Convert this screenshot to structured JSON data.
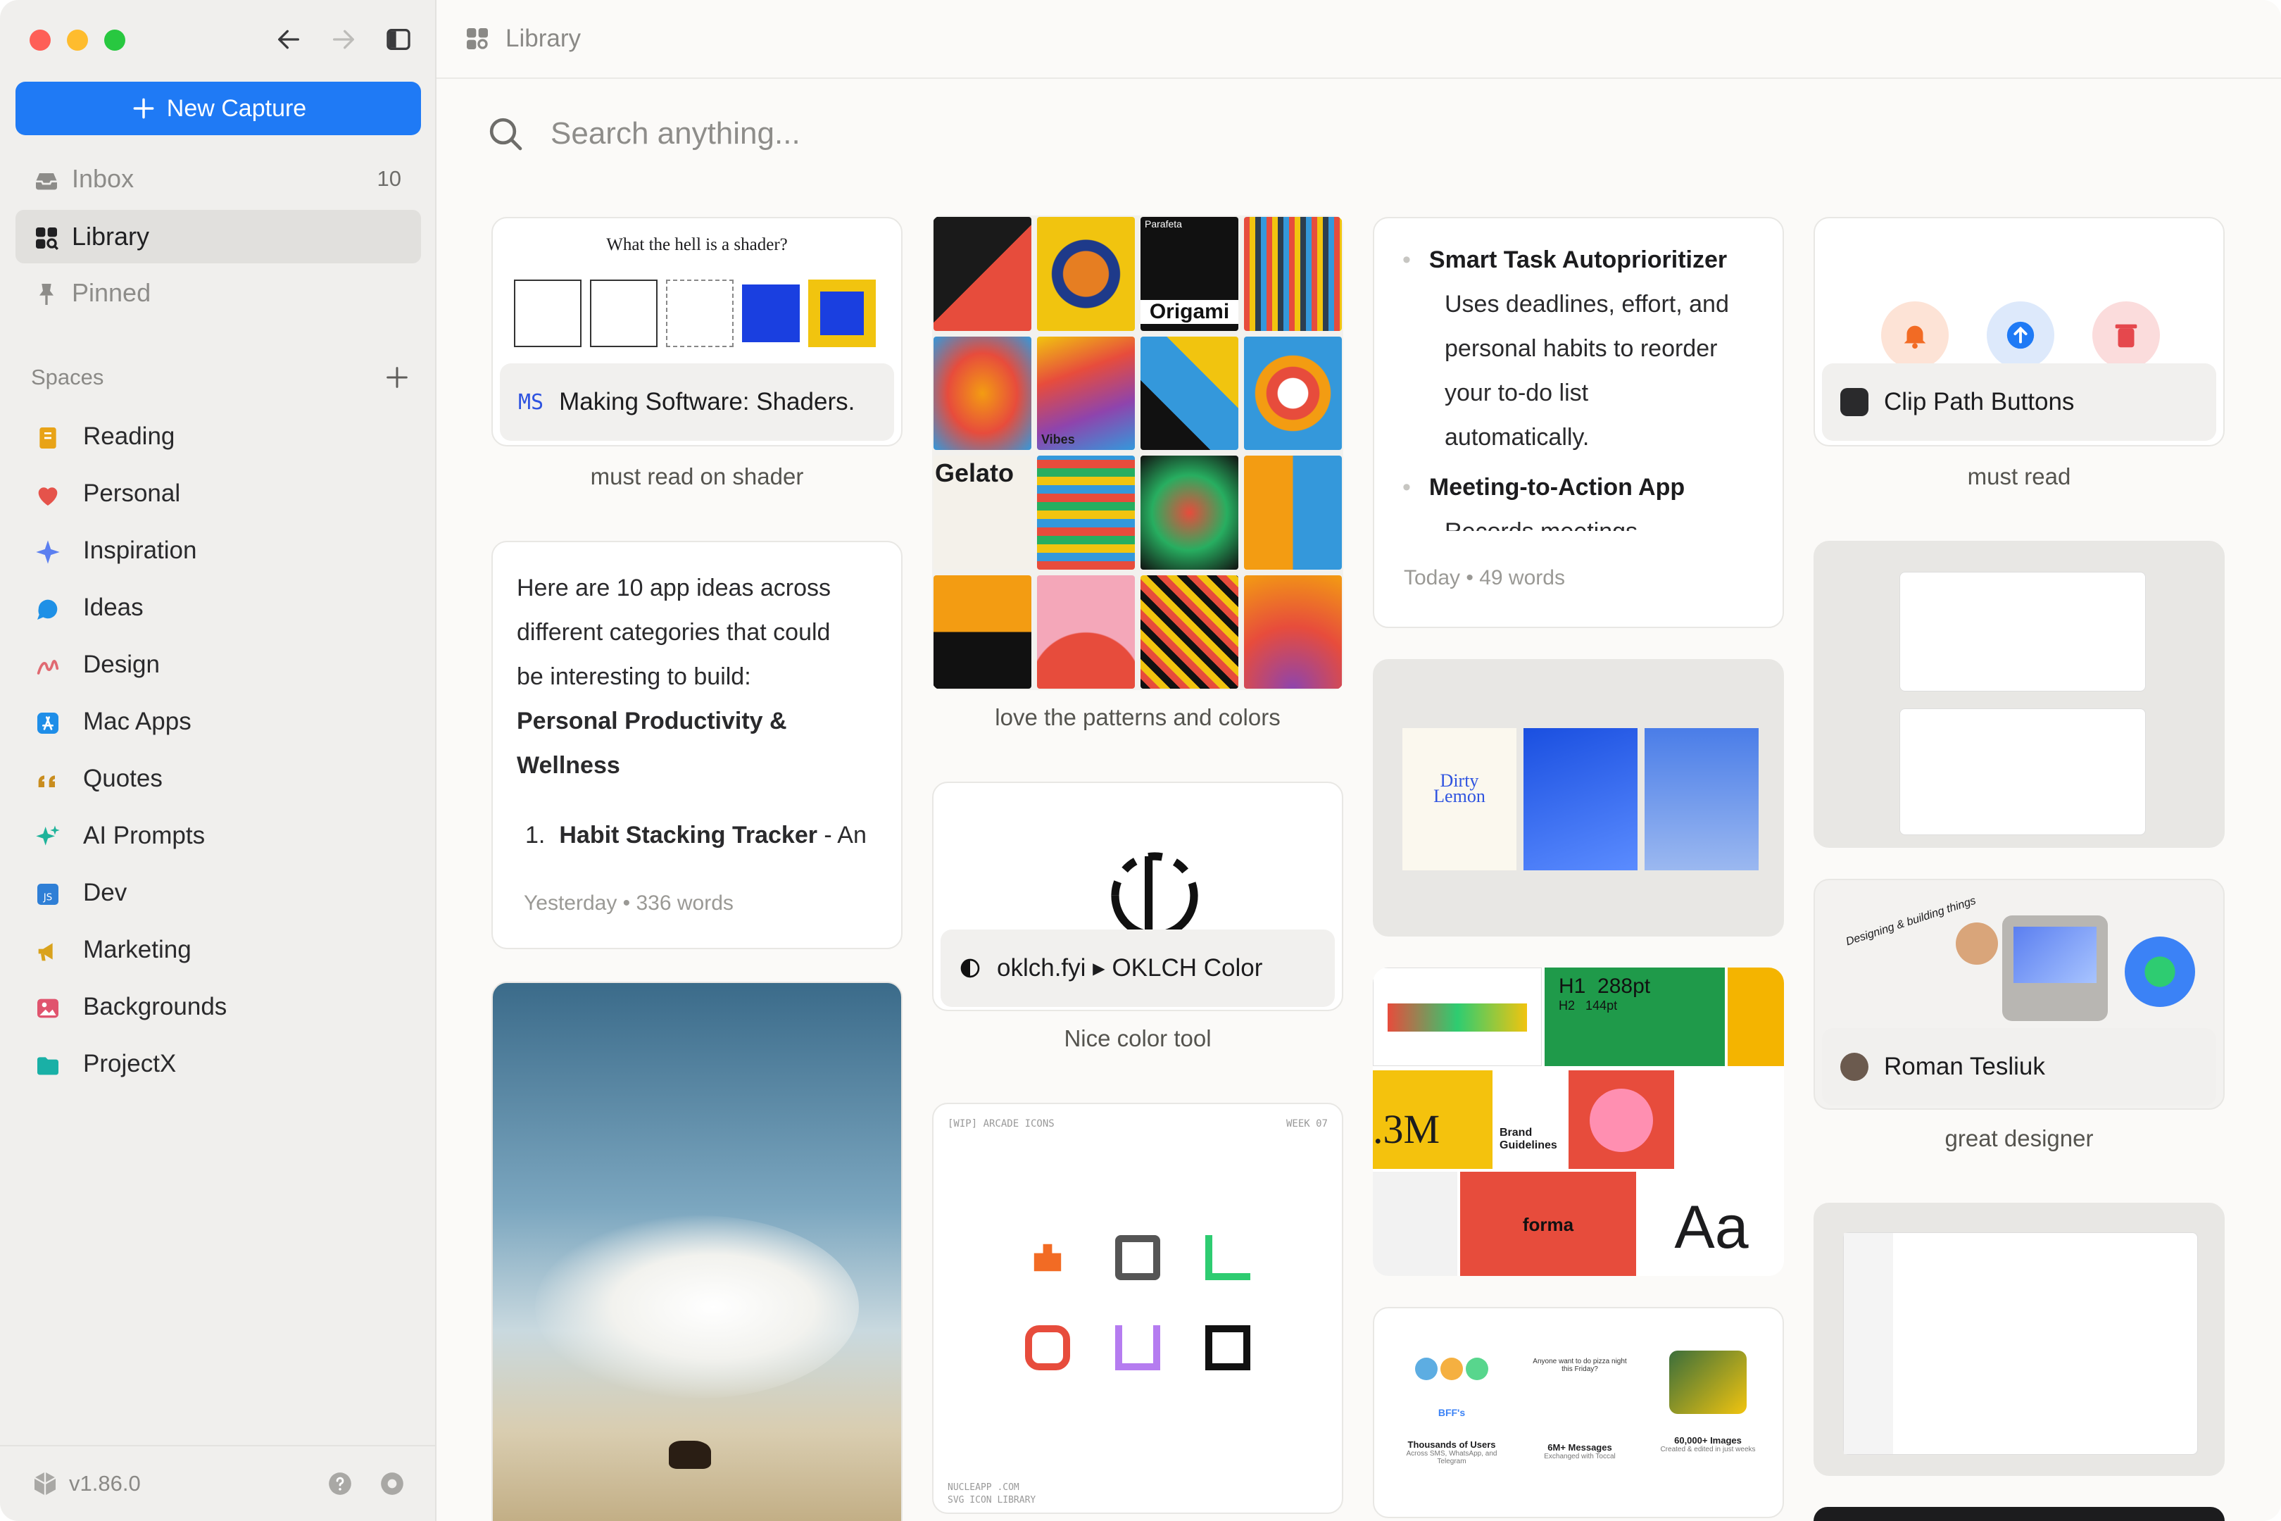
{
  "sidebar": {
    "new_capture": "New Capture",
    "nav": [
      {
        "label": "Inbox",
        "count": "10"
      },
      {
        "label": "Library"
      },
      {
        "label": "Pinned"
      }
    ],
    "spaces_title": "Spaces",
    "spaces": [
      {
        "label": "Reading",
        "icon": "book-icon",
        "color": "#e8a317"
      },
      {
        "label": "Personal",
        "icon": "heart-icon",
        "color": "#e5534b"
      },
      {
        "label": "Inspiration",
        "icon": "sparkle-icon",
        "color": "#5b7ff0"
      },
      {
        "label": "Ideas",
        "icon": "chat-bubble-icon",
        "color": "#1e90e6"
      },
      {
        "label": "Design",
        "icon": "squiggle-icon",
        "color": "#e06a72"
      },
      {
        "label": "Mac Apps",
        "icon": "app-store-icon",
        "color": "#1f8ee8"
      },
      {
        "label": "Quotes",
        "icon": "quote-icon",
        "color": "#c98d1e"
      },
      {
        "label": "AI Prompts",
        "icon": "ai-sparkle-icon",
        "color": "#1eb39a"
      },
      {
        "label": "Dev",
        "icon": "js-icon",
        "color": "#2f7fd6"
      },
      {
        "label": "Marketing",
        "icon": "megaphone-icon",
        "color": "#d9a21c"
      },
      {
        "label": "Backgrounds",
        "icon": "image-icon",
        "color": "#e0546e"
      },
      {
        "label": "ProjectX",
        "icon": "folder-icon",
        "color": "#19b0a6"
      }
    ],
    "version": "v1.86.0"
  },
  "topbar": {
    "title": "Library"
  },
  "search": {
    "placeholder": "Search anything..."
  },
  "cards": {
    "shader": {
      "heading": "What the hell is a shader?",
      "badge": "MS",
      "title": "Making Software: Shaders.",
      "caption": "must read on shader"
    },
    "ideas": {
      "lines": [
        "Here are 10 app ideas across",
        "different categories that could",
        "be interesting to build:"
      ],
      "bold1": "Personal Productivity &",
      "bold2": "Wellness",
      "item_num": "1.",
      "item_bold": "Habit Stacking Tracker",
      "item_rest": " - An",
      "meta": "Yesterday • 336 words"
    },
    "patterns": {
      "caption": "love the patterns and colors",
      "label_origami": "Origami",
      "label_gelato": "Gelato",
      "label_vibes": "Vibes",
      "label_parafeta": "Parafeta"
    },
    "oklch": {
      "title": "oklch.fyi ▸ OKLCH Color",
      "caption": "Nice color tool"
    },
    "arcade": {
      "header_left": "[WIP] ARCADE ICONS",
      "header_right": "WEEK 07",
      "footer_left1": "NUCLEAPP .COM",
      "footer_left2": "SVG ICON LIBRARY"
    },
    "task": {
      "item1_title": "Smart Task Autoprioritizer",
      "item1_lines": [
        "Uses deadlines, effort, and",
        "personal habits to reorder",
        "your to-do list",
        "automatically."
      ],
      "item2_title": "Meeting-to-Action App",
      "item2_cut": "Records meetings",
      "meta": "Today • 49 words"
    },
    "dirty": {
      "title_line1": "Dirty",
      "title_line2": "Lemon"
    },
    "forma": {
      "h1": "H1",
      "size1": "288pt",
      "h2": "H2",
      "size2": "144pt",
      "big_num": ".3M",
      "brand": "Brand Guidelines",
      "forma": "forma",
      "aa": "Aa"
    },
    "stats": {
      "items": [
        {
          "title": "Thousands of Users",
          "sub": "Across SMS, WhatsApp, and Telegram"
        },
        {
          "title": "6M+ Messages",
          "sub": "Exchanged with Toccal"
        },
        {
          "title": "60,000+ Images",
          "sub": "Created & edited in just weeks"
        }
      ],
      "badge": "BFF's",
      "chat": "Anyone want to do pizza night this Friday?"
    },
    "clip": {
      "title": "Clip Path Buttons",
      "caption": "must read"
    },
    "roman": {
      "title": "Roman Tesliuk",
      "caption": "great designer",
      "sticker": "Designing & building things"
    }
  },
  "colors": {
    "accent": "#1f7af5",
    "sidebar_bg": "#f0efed",
    "main_bg": "#fbfaf8"
  }
}
